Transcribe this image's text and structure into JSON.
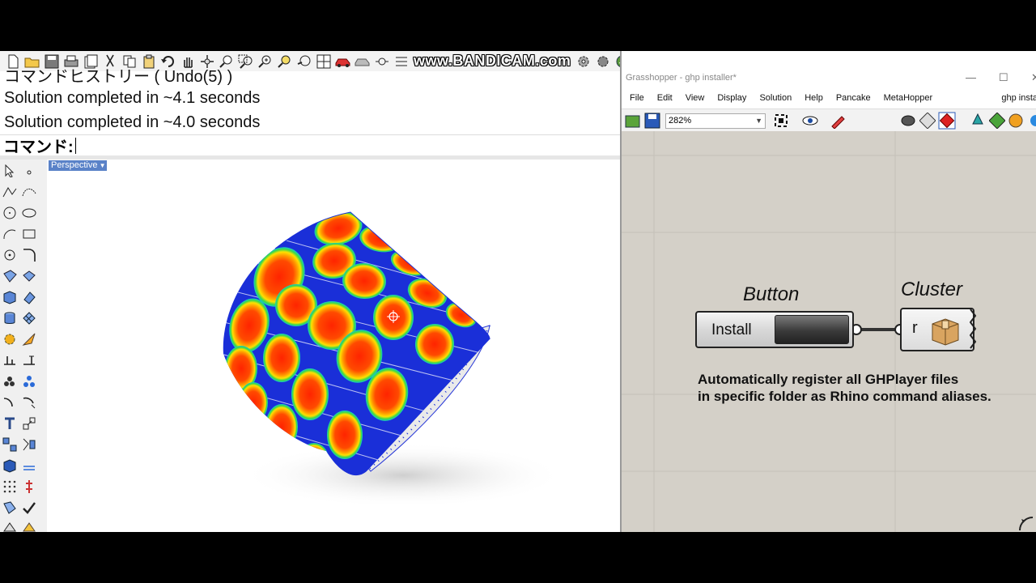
{
  "rhino": {
    "watermark": "www.BANDICAM.com",
    "command_history": [
      "コマンドヒストリー ( Undo(5) )",
      "Solution completed in ~4.1 seconds",
      "Solution completed in ~4.0 seconds"
    ],
    "command_prompt": "コマンド:",
    "viewport_tab": "Perspective"
  },
  "grasshopper": {
    "window_title": "Grasshopper - ghp installer*",
    "menu": [
      "File",
      "Edit",
      "View",
      "Display",
      "Solution",
      "Help",
      "Pancake",
      "MetaHopper"
    ],
    "document_tab": "ghp insta",
    "zoom": "282%",
    "button_label": "Button",
    "cluster_label": "Cluster",
    "install_text": "Install",
    "cluster_input": "r",
    "description_line1": "Automatically register all GHPlayer files",
    "description_line2": "in specific folder as Rhino command aliases."
  },
  "colors": {
    "surface_blue": "#1a2fd8",
    "blob_red": "#ff2a00",
    "blob_yellow": "#ffd000",
    "blob_green": "#16d060",
    "gh_canvas": "#d4d0c8",
    "viewport_tab": "#5a82c8"
  }
}
